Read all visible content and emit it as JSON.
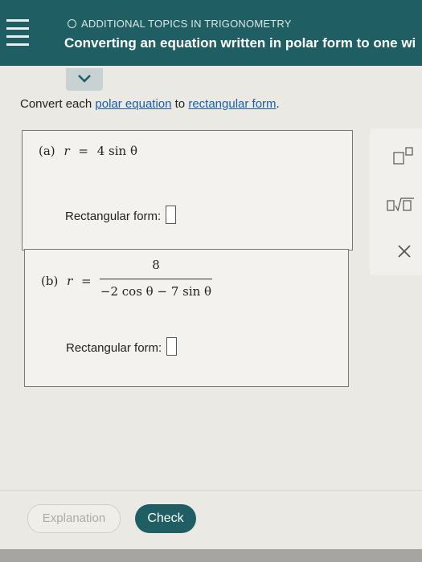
{
  "header": {
    "topic": "ADDITIONAL TOPICS IN TRIGONOMETRY",
    "title": "Converting an equation written in polar form to one wi"
  },
  "instructions": {
    "prefix": "Convert each ",
    "link1": "polar equation",
    "middle": " to ",
    "link2": "rectangular form",
    "suffix": "."
  },
  "part_a": {
    "label": "(a)",
    "lhs": "r",
    "equals": "=",
    "rhs": "4 sin θ",
    "answer_label": "Rectangular form:",
    "answer_value": ""
  },
  "part_b": {
    "label": "(b)",
    "lhs": "r",
    "equals": "=",
    "numerator": "8",
    "denominator": "−2 cos θ − 7 sin θ",
    "answer_label": "Rectangular form:",
    "answer_value": ""
  },
  "buttons": {
    "explanation": "Explanation",
    "check": "Check"
  },
  "colors": {
    "header": "#1f5f63",
    "link": "#1a5fa8",
    "check_button": "#1f5f63"
  }
}
